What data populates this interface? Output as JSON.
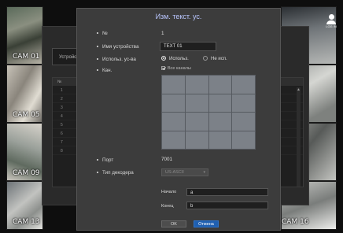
{
  "cameras": {
    "left": [
      "CAM 01",
      "CAM 05",
      "CAM 09",
      "CAM 13"
    ],
    "right_bottom": "CAM 16"
  },
  "login": {
    "label": "LOG IN",
    "icon": "user-icon"
  },
  "background_window": {
    "tab_label": "Устройс",
    "table_header": "№",
    "rows": [
      "1",
      "2",
      "3",
      "4",
      "5",
      "6",
      "7",
      "8"
    ]
  },
  "dialog": {
    "title": "Изм. текст. ус.",
    "fields": {
      "number_label": "№",
      "number_value": "1",
      "device_name_label": "Имя устройства",
      "device_name_value": "TEXT 01",
      "use_label": "Использ. ус-ва",
      "use_on": "Использ.",
      "use_off": "Не исп.",
      "channel_label": "Кан.",
      "all_channels": "Все каналы",
      "port_label": "Порт",
      "port_value": "7001",
      "decoder_type_label": "Тип декодера",
      "decoder_type_value": "US-ASCII",
      "start_label": "Начало",
      "start_value": "a",
      "end_label": "Конец",
      "end_value": "b"
    },
    "buttons": {
      "ok": "OK",
      "cancel": "Отмена"
    }
  },
  "colors": {
    "accent_blue": "#1f5fb0",
    "title_color": "#b9c6ff",
    "dialog_bg": "#3c3c3c"
  }
}
